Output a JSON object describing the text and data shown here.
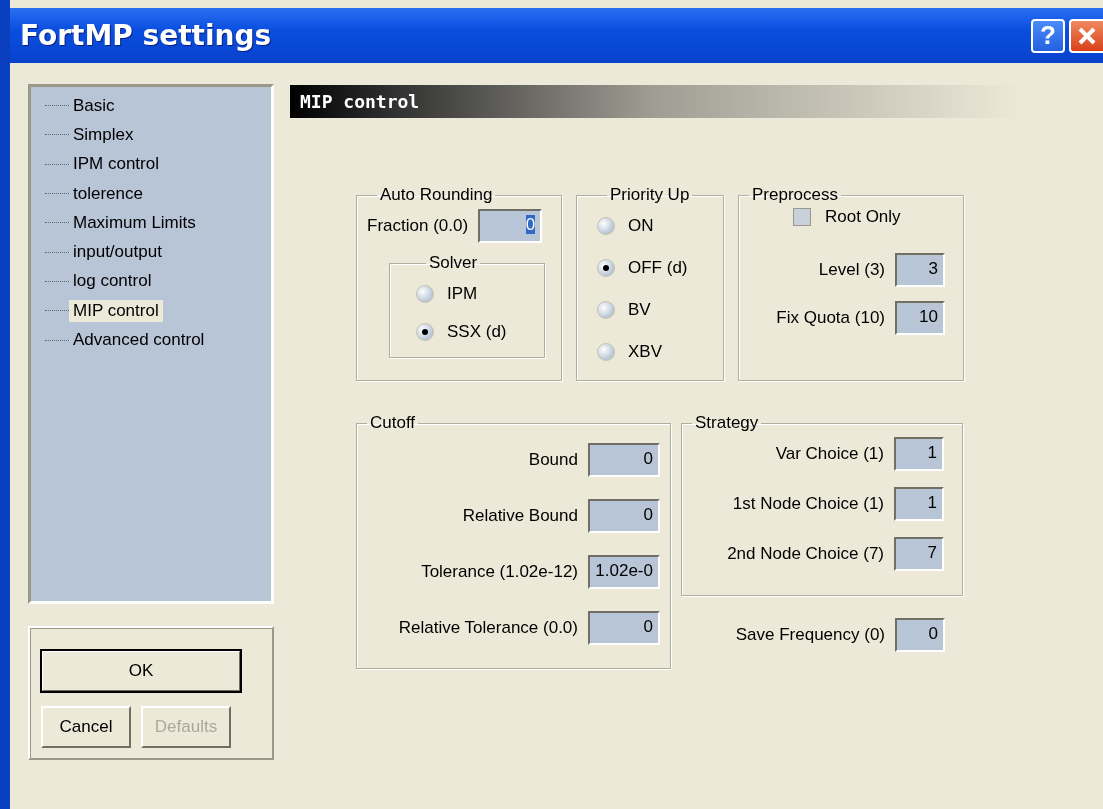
{
  "window": {
    "title": "FortMP settings",
    "help_glyph": "?"
  },
  "tree": {
    "items": [
      {
        "label": "Basic",
        "selected": false
      },
      {
        "label": "Simplex",
        "selected": false
      },
      {
        "label": "IPM control",
        "selected": false
      },
      {
        "label": "tolerence",
        "selected": false
      },
      {
        "label": "Maximum Limits",
        "selected": false
      },
      {
        "label": "input/output",
        "selected": false
      },
      {
        "label": "log control",
        "selected": false
      },
      {
        "label": "MIP control",
        "selected": true
      },
      {
        "label": "Advanced control",
        "selected": false
      }
    ]
  },
  "buttons": [
    {
      "label": "OK",
      "default": true,
      "disabled": false
    },
    {
      "label": "Cancel",
      "default": false,
      "disabled": false
    },
    {
      "label": "Defaults",
      "default": false,
      "disabled": true
    }
  ],
  "page_title": "MIP control",
  "auto_rounding": {
    "title": "Auto Rounding",
    "fraction": {
      "label": "Fraction (0.0)",
      "value": "0",
      "focused": true
    },
    "solver": {
      "title": "Solver",
      "options": [
        {
          "label": "IPM",
          "selected": false
        },
        {
          "label": "SSX (d)",
          "selected": true
        }
      ]
    }
  },
  "priority_up": {
    "title": "Priority Up",
    "options": [
      {
        "label": "ON",
        "selected": false
      },
      {
        "label": "OFF (d)",
        "selected": true
      },
      {
        "label": "BV",
        "selected": false
      },
      {
        "label": "XBV",
        "selected": false
      }
    ]
  },
  "preprocess": {
    "title": "Preprocess",
    "root_only": {
      "label": "Root Only",
      "checked": false,
      "disabled": true
    },
    "fields": [
      {
        "label": "Level (3)",
        "value": "3"
      },
      {
        "label": "Fix Quota (10)",
        "value": "10"
      }
    ]
  },
  "cutoff": {
    "title": "Cutoff",
    "fields": [
      {
        "label": "Bound",
        "value": "0"
      },
      {
        "label": "Relative Bound",
        "value": "0"
      },
      {
        "label": "Tolerance (1.02e-12)",
        "value": "1.02e-0"
      },
      {
        "label": "Relative Tolerance (0.0)",
        "value": "0"
      }
    ]
  },
  "strategy": {
    "title": "Strategy",
    "fields": [
      {
        "label": "Var Choice (1)",
        "value": "1"
      },
      {
        "label": "1st Node Choice (1)",
        "value": "1"
      },
      {
        "label": "2nd Node Choice (7)",
        "value": "7"
      }
    ]
  },
  "save_frequency": {
    "label": "Save Frequency (0)",
    "value": "0"
  }
}
